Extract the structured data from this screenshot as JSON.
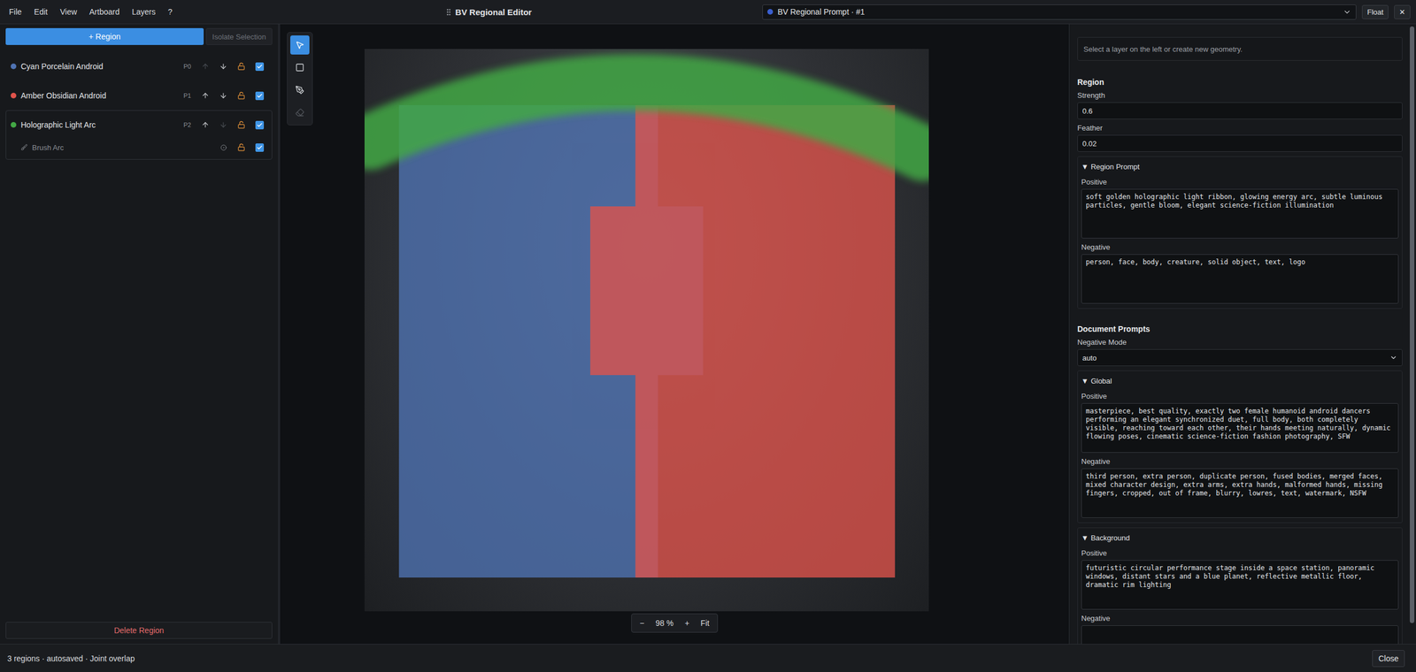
{
  "menubar": {
    "menus": [
      "File",
      "Edit",
      "View",
      "Artboard",
      "Layers",
      "?"
    ],
    "title": "BV Regional Editor",
    "prompt_select": "BV Regional Prompt · #1",
    "buttons": [
      "Float",
      "✕"
    ]
  },
  "left_panel": {
    "add_button": "+ Region",
    "isolate_button": {
      "label": "Isolate Selection",
      "disabled": true
    },
    "regions": [
      {
        "name": "Cyan Porcelain Android",
        "priority": "P0",
        "color": "#4f73b3",
        "up_disabled": true,
        "down_disabled": false,
        "locked": false,
        "visible": true,
        "expanded": false,
        "children": []
      },
      {
        "name": "Amber Obsidian Android",
        "priority": "P1",
        "color": "#e0534b",
        "up_disabled": false,
        "down_disabled": false,
        "locked": false,
        "visible": true,
        "expanded": false,
        "children": []
      },
      {
        "name": "Holographic Light Arc",
        "priority": "P2",
        "color": "#43a845",
        "up_disabled": false,
        "down_disabled": true,
        "locked": false,
        "visible": true,
        "expanded": true,
        "children": [
          {
            "name": "Brush Arc",
            "locked": false,
            "visible": true
          }
        ]
      }
    ],
    "delete_button": "Delete Region"
  },
  "tools": [
    {
      "kind": "select",
      "selected": true,
      "disabled": false
    },
    {
      "kind": "rect",
      "selected": false,
      "disabled": false
    },
    {
      "kind": "polygon",
      "selected": false,
      "disabled": false
    },
    {
      "kind": "erase",
      "selected": false,
      "disabled": true
    }
  ],
  "zoom": {
    "minus": "−",
    "value": "98 %",
    "plus": "+",
    "fit": "Fit"
  },
  "inspector": {
    "hint": "Select a layer on the left or create new geometry.",
    "region": {
      "heading": "Region",
      "strength_label": "Strength",
      "strength": "0.6",
      "feather_label": "Feather",
      "feather": "0.02",
      "prompt": {
        "toggle": "▼",
        "title": "Region Prompt",
        "expanded": true,
        "positive_label": "Positive",
        "positive": "soft golden holographic light ribbon, glowing energy arc, subtle luminous particles, gentle bloom, elegant science-fiction illumination",
        "negative_label": "Negative",
        "negative": "person, face, body, creature, solid object, text, logo"
      }
    },
    "document": {
      "heading": "Document Prompts",
      "negative_mode_label": "Negative Mode",
      "negative_mode": "auto",
      "sections": [
        {
          "toggle": "▼",
          "title": "Global",
          "expanded": true,
          "positive_label": "Positive",
          "positive": "masterpiece, best quality, exactly two female humanoid android dancers performing an elegant synchronized duet, full body, both completely visible, reaching toward each other, their hands meeting naturally, dynamic flowing poses, cinematic science-fiction fashion photography, SFW",
          "negative_label": "Negative",
          "negative": "third person, extra person, duplicate person, fused bodies, merged faces, mixed character design, extra arms, extra hands, malformed hands, missing fingers, cropped, out of frame, blurry, lowres, text, watermark, NSFW"
        },
        {
          "toggle": "▼",
          "title": "Background",
          "expanded": true,
          "positive_label": "Positive",
          "positive": "futuristic circular performance stage inside a space station, panoramic windows, distant stars and a blue planet, reflective metallic floor, dramatic rim lighting",
          "negative_label": "Negative",
          "negative": ""
        }
      ]
    },
    "scrollbar": {
      "level": 0.97
    }
  },
  "status_bar": {
    "text": "3 regions · autosaved · Joint overlap",
    "close": "Close"
  }
}
